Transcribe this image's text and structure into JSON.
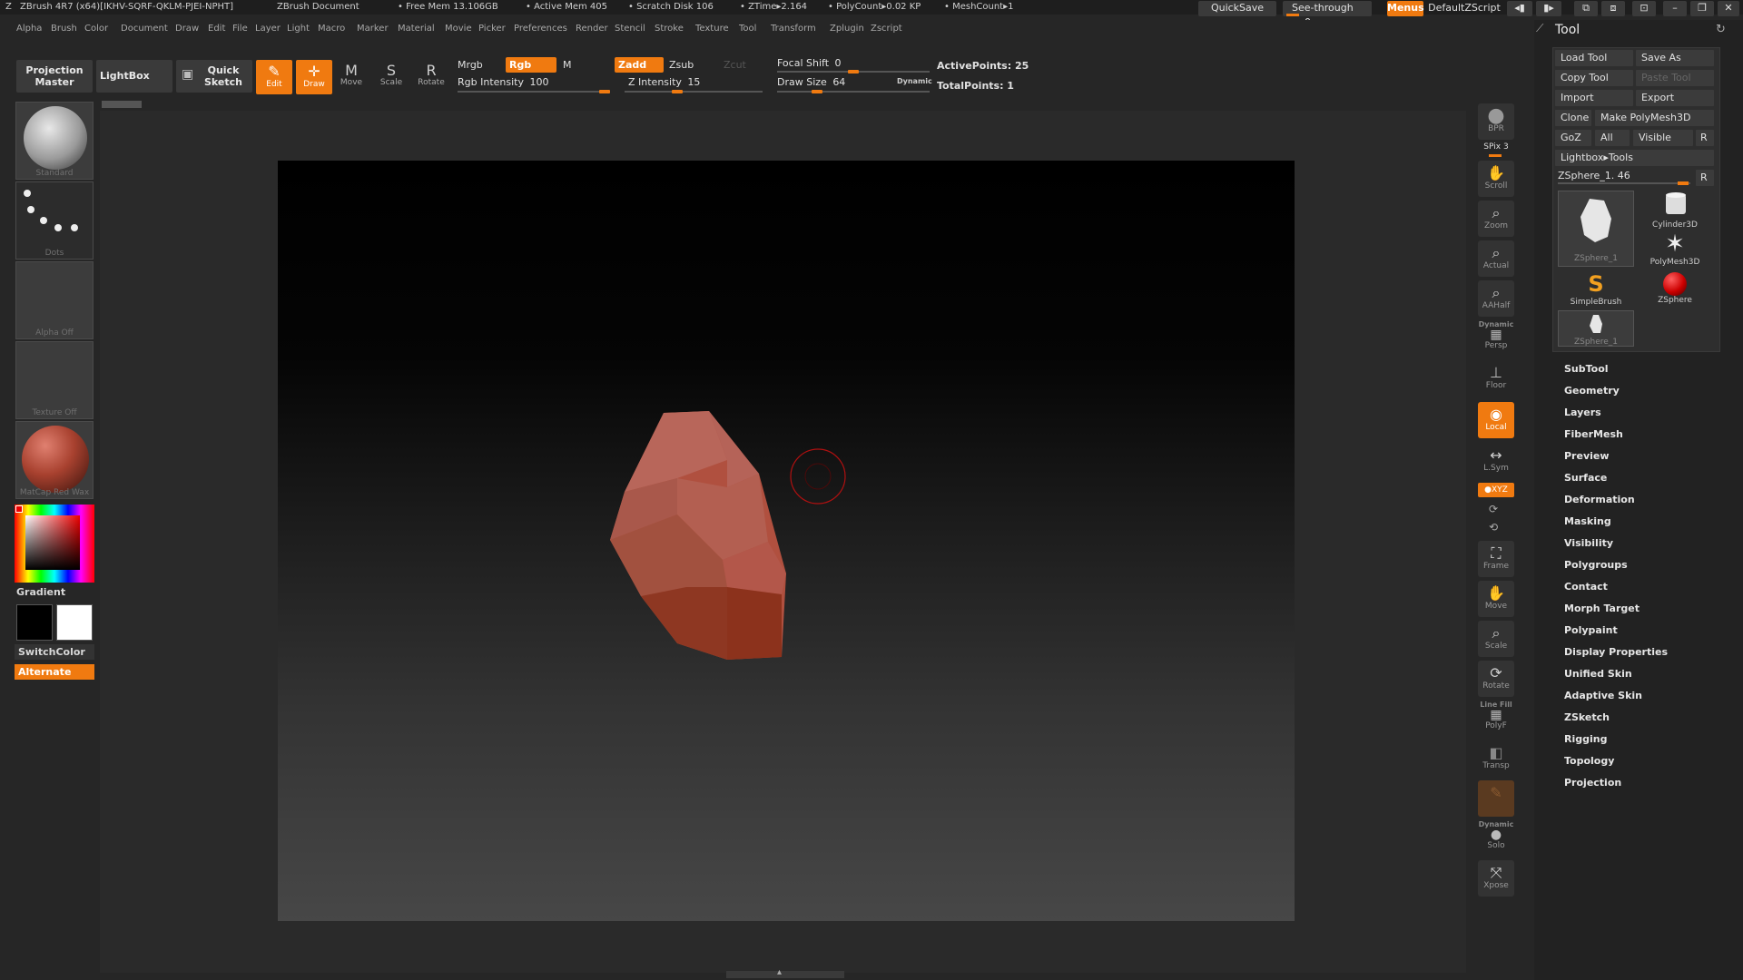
{
  "titlebar": {
    "app": "ZBrush 4R7 (x64)[IKHV-SQRF-QKLM-PJEI-NPHT]",
    "document": "ZBrush Document",
    "free_mem": "• Free Mem 13.106GB",
    "active_mem": "• Active Mem 405",
    "scratch": "• Scratch Disk 106",
    "ztime": "• ZTime▸2.164",
    "polycount": "• PolyCount▸0.02 KP",
    "meshcount": "• MeshCount▸1",
    "quicksave": "QuickSave",
    "see_through": "See-through",
    "see_through_value": "0",
    "menus": "Menus",
    "default_zscript": "DefaultZScript"
  },
  "menu": [
    "Alpha",
    "Brush",
    "Color",
    "Document",
    "Draw",
    "Edit",
    "File",
    "Layer",
    "Light",
    "Macro",
    "Marker",
    "Material",
    "Movie",
    "Picker",
    "Preferences",
    "Render",
    "Stencil",
    "Stroke",
    "Texture",
    "Tool",
    "Transform",
    "Zplugin",
    "Zscript"
  ],
  "shelf": {
    "projection_master_1": "Projection",
    "projection_master_2": "Master",
    "lightbox": "LightBox",
    "quick_sketch_1": "Quick",
    "quick_sketch_2": "Sketch",
    "edit": "Edit",
    "draw": "Draw",
    "move": "Move",
    "scale": "Scale",
    "rotate": "Rotate",
    "mrgb": "Mrgb",
    "rgb": "Rgb",
    "m": "M",
    "rgb_intensity_label": "Rgb Intensity",
    "rgb_intensity": "100",
    "zadd": "Zadd",
    "zsub": "Zsub",
    "zcut": "Zcut",
    "z_intensity_label": "Z Intensity",
    "z_intensity": "15",
    "focal_shift_label": "Focal Shift",
    "focal_shift": "0",
    "draw_size_label": "Draw Size",
    "draw_size": "64",
    "dynamic": "Dynamic",
    "active_points": "ActivePoints: 25",
    "total_points": "TotalPoints: 1"
  },
  "left": {
    "brush": "Standard",
    "stroke": "Dots",
    "alpha": "Alpha  Off",
    "texture": "Texture  Off",
    "material": "MatCap  Red  Wax",
    "gradient": "Gradient",
    "switchcolor": "SwitchColor",
    "alternate": "Alternate"
  },
  "rightshelf": {
    "bpr": "BPR",
    "spix": "SPix",
    "spix_value": "3",
    "scroll": "Scroll",
    "zoom": "Zoom",
    "actual": "Actual",
    "aahalf": "AAHalf",
    "dynamic": "Dynamic",
    "persp": "Persp",
    "floor": "Floor",
    "local": "Local",
    "lsym": "L.Sym",
    "xyz": "●XYZ",
    "frame": "Frame",
    "move": "Move",
    "scale": "Scale",
    "rotate": "Rotate",
    "line_fill": "Line Fill",
    "polyf": "PolyF",
    "transp": "Transp",
    "dynamic2": "Dynamic",
    "solo": "Solo",
    "xpose": "Xpose"
  },
  "toolpanel": {
    "title": "Tool",
    "load_tool": "Load Tool",
    "save_as": "Save As",
    "copy_tool": "Copy Tool",
    "paste_tool": "Paste Tool",
    "import": "Import",
    "export": "Export",
    "clone": "Clone",
    "make_polymesh": "Make PolyMesh3D",
    "goz": "GoZ",
    "all": "All",
    "visible": "Visible",
    "r": "R",
    "lightbox_tools": "Lightbox▸Tools",
    "current_tool": "ZSphere_1. 46",
    "r2": "R",
    "thumbs": [
      "ZSphere_1",
      "Cylinder3D",
      "PolyMesh3D",
      "SimpleBrush",
      "ZSphere",
      "ZSphere_1"
    ],
    "sections": [
      "SubTool",
      "Geometry",
      "Layers",
      "FiberMesh",
      "Preview",
      "Surface",
      "Deformation",
      "Masking",
      "Visibility",
      "Polygroups",
      "Contact",
      "Morph Target",
      "Polypaint",
      "Display Properties",
      "Unified Skin",
      "Adaptive Skin",
      "ZSketch",
      "Rigging",
      "Topology",
      "Projection"
    ]
  },
  "colors": {
    "accent": "#f07a10",
    "panel_bg": "#262626",
    "mesh": "#b0503f"
  }
}
